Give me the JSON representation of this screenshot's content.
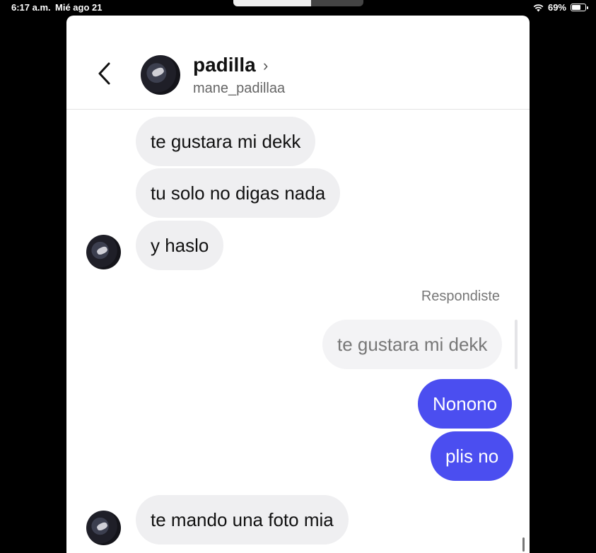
{
  "status_bar": {
    "time": "6:17 a.m.",
    "date": "Mié ago 21",
    "battery": "69%",
    "battery_level": 0.69,
    "icons": [
      "wifi-icon",
      "battery-icon"
    ]
  },
  "header": {
    "name": "padilla",
    "username": "mane_padillaa",
    "icons": [
      "chevron-left-icon",
      "chevron-right-icon",
      "avatar"
    ]
  },
  "messages": [
    {
      "direction": "incoming",
      "text": "te gustara mi dekk"
    },
    {
      "direction": "incoming",
      "text": "tu solo no digas nada"
    },
    {
      "direction": "incoming",
      "text": "y haslo",
      "show_avatar": true
    },
    {
      "direction": "reply_label",
      "text": "Respondiste"
    },
    {
      "direction": "quoted_reply",
      "text": "te gustara mi dekk"
    },
    {
      "direction": "outgoing",
      "text": "Nonono"
    },
    {
      "direction": "outgoing",
      "text": "plis no"
    },
    {
      "direction": "incoming",
      "text": "te mando una foto mia",
      "show_avatar": true
    }
  ],
  "colors": {
    "outgoing_bubble": "#4b4ef0",
    "incoming_bubble": "#efeff1",
    "background": "#ffffff"
  }
}
